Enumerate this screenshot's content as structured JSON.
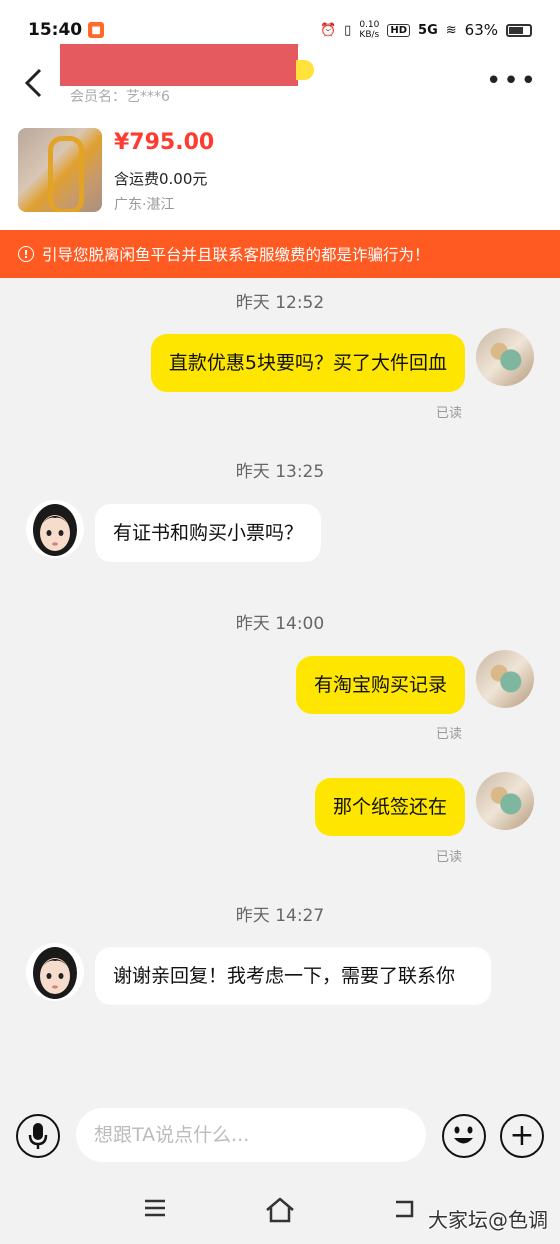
{
  "status_bar": {
    "time": "15:40",
    "net_speed_value": "0.10",
    "net_speed_unit": "KB/s",
    "hd": "HD",
    "signal": "5G",
    "battery": "63%"
  },
  "header": {
    "member_name": "会员名：艺***6",
    "product": {
      "price": "¥795.00",
      "shipping": "含运费0.00元",
      "location": "广东·湛江"
    }
  },
  "warning": {
    "text": "引导您脱离闲鱼平台并且联系客服缴费的都是诈骗行为！"
  },
  "messages": [
    {
      "type": "time",
      "text": "昨天 12:52"
    },
    {
      "type": "mine",
      "text": "直款优惠5块要吗？买了大件回血",
      "status": "已读"
    },
    {
      "type": "time",
      "text": "昨天 13:25"
    },
    {
      "type": "theirs",
      "text": "有证书和购买小票吗？"
    },
    {
      "type": "time",
      "text": "昨天 14:00"
    },
    {
      "type": "mine",
      "text": "有淘宝购买记录",
      "status": "已读"
    },
    {
      "type": "mine",
      "text": "那个纸签还在",
      "status": "已读"
    },
    {
      "type": "time",
      "text": "昨天 14:27"
    },
    {
      "type": "theirs",
      "text": "谢谢亲回复！我考虑一下，需要了联系你"
    }
  ],
  "input": {
    "placeholder": "想跟TA说点什么..."
  },
  "watermark": "大家坛@色调",
  "colors": {
    "accent_yellow": "#ffe600",
    "warning_orange": "#ff5a22",
    "price_red": "#ff3b30"
  }
}
